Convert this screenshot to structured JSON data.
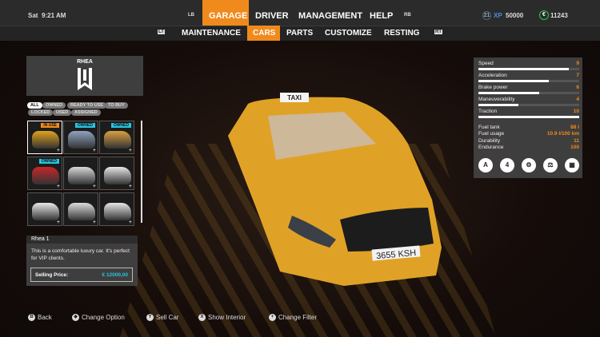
{
  "status": {
    "day": "Sat",
    "time": "9:21 AM",
    "level": "21",
    "xp_label": "XP",
    "xp": "50000",
    "money": "11243"
  },
  "nav": {
    "lb": "LB",
    "rb": "RB",
    "items": [
      "GARAGE",
      "DRIVER",
      "MANAGEMENT",
      "HELP"
    ],
    "active": "GARAGE"
  },
  "subnav": {
    "lt": "LT",
    "rt": "RT",
    "items": [
      "MAINTENANCE",
      "CARS",
      "PARTS",
      "CUSTOMIZE",
      "RESTING"
    ],
    "active": "CARS"
  },
  "brand": {
    "name": "RHEA"
  },
  "filters": [
    "ALL",
    "OWNED",
    "READY TO USE",
    "TO BUY",
    "LOCKED",
    "USED",
    "ASSIGNED"
  ],
  "cars": [
    {
      "badge": "IN USE",
      "color": "#e2a21c"
    },
    {
      "badge": "OWNED",
      "color": "#8fa3c0"
    },
    {
      "badge": "OWNED",
      "color": "#d9a040"
    },
    {
      "badge": "OWNED",
      "color": "#c8262a"
    },
    {
      "badge": "",
      "color": "#d8d8d8"
    },
    {
      "badge": "",
      "color": "#e6e6e6"
    },
    {
      "badge": "",
      "color": "#e8e8e8"
    },
    {
      "badge": "",
      "color": "#dcdcdc"
    },
    {
      "badge": "",
      "color": "#e6e6e6"
    }
  ],
  "info": {
    "title": "Rhea 1",
    "description": "This is a comfortable luxury car. It's perfect for VIP clients.",
    "price_label": "Selling Price:",
    "price": "€ 12000,00"
  },
  "stats": [
    {
      "label": "Speed",
      "value": "9",
      "level": 0.9
    },
    {
      "label": "Acceleration",
      "value": "7",
      "level": 0.7
    },
    {
      "label": "Brake power",
      "value": "6",
      "level": 0.6
    },
    {
      "label": "Maneuverability",
      "value": "4",
      "level": 0.4
    },
    {
      "label": "Traction",
      "value": "10",
      "level": 1.0
    }
  ],
  "specs": [
    {
      "label": "Fuel tank",
      "value": "88 l"
    },
    {
      "label": "Fuel usage",
      "value": "10.9 l/100 km"
    },
    {
      "label": "Durability",
      "value": "11"
    },
    {
      "label": "Endurance",
      "value": "100"
    }
  ],
  "feature_icons": [
    "automatic-gearbox-icon",
    "seats-4-icon",
    "engine-icon",
    "weight-icon",
    "radiator-icon"
  ],
  "taxi": {
    "sign": "TAXI",
    "plate": "3655 KSH"
  },
  "hints": [
    {
      "btn": "B",
      "label": "Back"
    },
    {
      "btn": "◆",
      "label": "Change Option"
    },
    {
      "btn": "Y",
      "label": "Sell Car"
    },
    {
      "btn": "X",
      "label": "Show Interior"
    },
    {
      "btn": "+",
      "label": "Change Filter"
    }
  ],
  "colors": {
    "accent": "#f08a1c",
    "price": "#29c4e0",
    "owned_badge": "#29c4e0",
    "money": "#2ec45a"
  }
}
